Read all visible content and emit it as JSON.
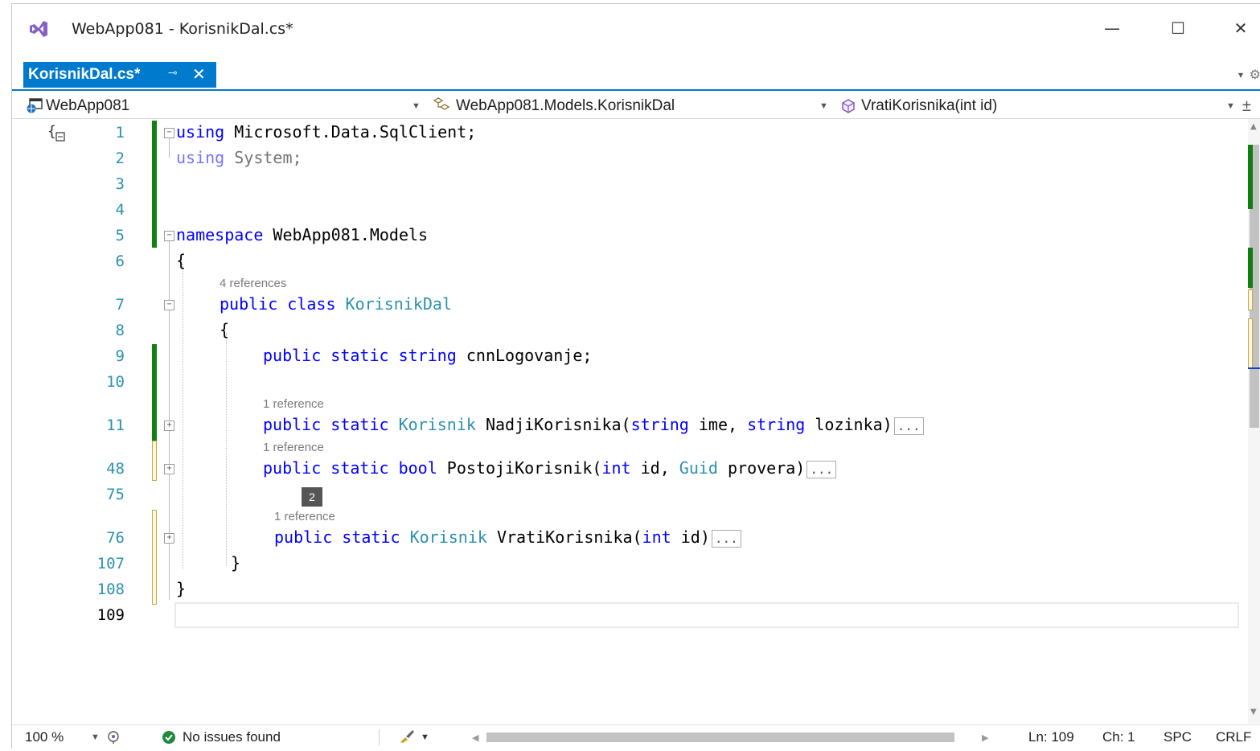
{
  "window": {
    "title": "WebApp081 - KorisnikDal.cs*",
    "minimize_glyph": "—",
    "maximize_glyph": "☐",
    "close_glyph": "✕"
  },
  "tab": {
    "label": "KorisnikDal.cs*",
    "pin_glyph": "⊸",
    "close_glyph": "✕"
  },
  "navbar": {
    "project": "WebApp081",
    "type": "WebApp081.Models.KorisnikDal",
    "member": "VratiKorisnika(int id)"
  },
  "lines": {
    "n1": "1",
    "n2": "2",
    "n3": "3",
    "n4": "4",
    "n5": "5",
    "n6": "6",
    "n7": "7",
    "n8": "8",
    "n9": "9",
    "n10": "10",
    "n11": "11",
    "n48": "48",
    "n75": "75",
    "n76": "76",
    "n107": "107",
    "n108": "108",
    "n109": "109"
  },
  "code": {
    "l1_kw": "using",
    "l1_rest": " Microsoft.Data.SqlClient;",
    "l2_kw": "using",
    "l2_rest": " System;",
    "l5_kw": "namespace",
    "l5_rest": " WebApp081.Models",
    "l6": "{",
    "ref7": "4 references",
    "l7_kw": "public class",
    "l7_type": " KorisnikDal",
    "l8": "{",
    "l9_kw": "public static string",
    "l9_rest": " cnnLogovanje;",
    "ref11": "1 reference",
    "l11_kw": "public static",
    "l11_type": " Korisnik",
    "l11_name": " NadjiKorisnika(",
    "l11_kw2": "string",
    "l11_mid": " ime, ",
    "l11_kw3": "string",
    "l11_end": " lozinka)",
    "ref48": "1 reference",
    "l48_kw": "public static bool",
    "l48_name": " PostojiKorisnik(",
    "l48_kw2": "int",
    "l48_mid": " id, ",
    "l48_type": "Guid",
    "l48_end": " provera)",
    "badge": "2",
    "ref76": "1 reference",
    "l76_kw": "public static",
    "l76_type": " Korisnik",
    "l76_name": " VratiKorisnika(",
    "l76_kw2": "int",
    "l76_end": " id)",
    "l107": "}",
    "l108": "}",
    "ellipsis": "..."
  },
  "statusbar": {
    "zoom": "100 %",
    "issues": "No issues found",
    "ln": "Ln: 109",
    "ch": "Ch: 1",
    "spc": "SPC",
    "crlf": "CRLF"
  },
  "colors": {
    "accent": "#007acc",
    "keyword": "#0000ff",
    "type": "#2b91af",
    "change_saved": "#108010",
    "change_unsaved": "#c2a84a",
    "ok_green": "#1e8a3c"
  },
  "icons": [
    "vs-logo-icon",
    "project-icon",
    "class-icon",
    "method-icon",
    "ok-check-icon",
    "brush-icon",
    "namespace-icon"
  ]
}
